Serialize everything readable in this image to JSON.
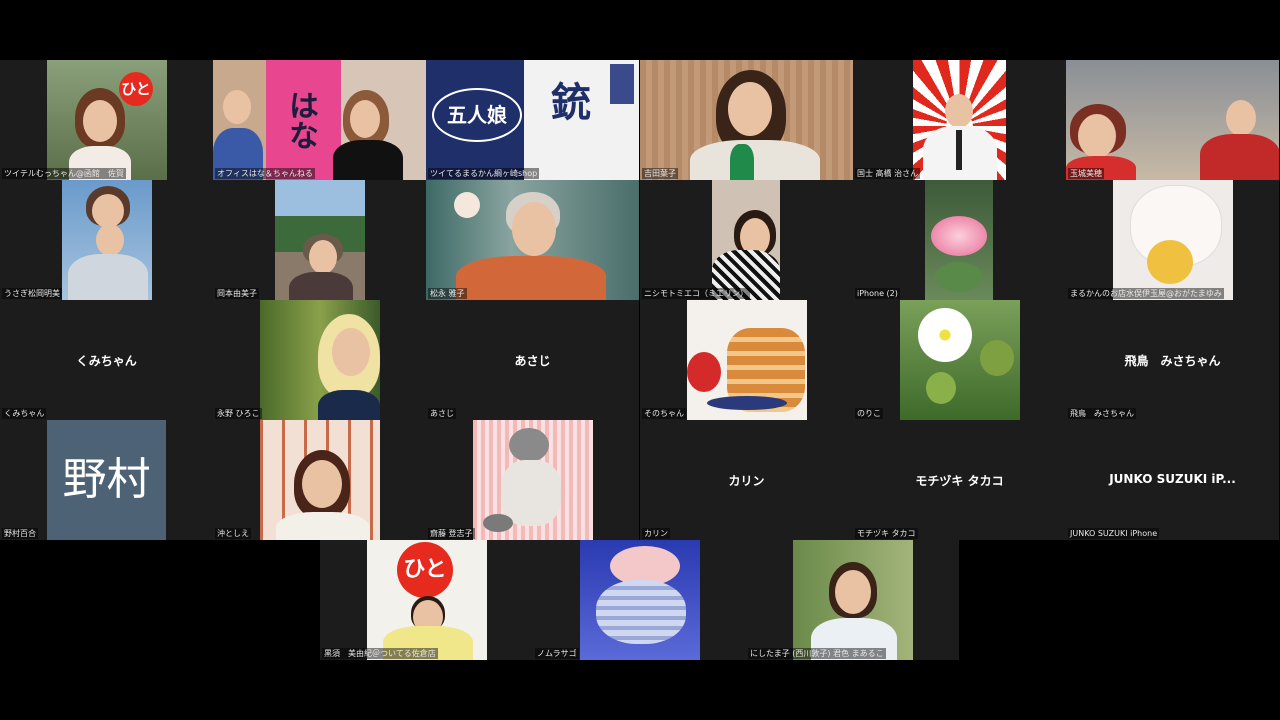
{
  "participants": [
    {
      "name": "ツイテルむっちゃん@函館　佐賀",
      "center": ""
    },
    {
      "name": "オフィスはな＆ちゃんねる",
      "center": ""
    },
    {
      "name": "ツイてるまるかん綱ヶ崎shop",
      "center": ""
    },
    {
      "name": "吉田葉子",
      "center": ""
    },
    {
      "name": "国士 髙橋 治さん",
      "center": ""
    },
    {
      "name": "玉城美穂",
      "center": ""
    },
    {
      "name": "うさぎ松岡明美",
      "center": ""
    },
    {
      "name": "岡本由美子",
      "center": ""
    },
    {
      "name": "松永 雅子",
      "center": ""
    },
    {
      "name": "ニシモトミエコ（ミエリン）",
      "center": ""
    },
    {
      "name": "iPhone (2)",
      "center": ""
    },
    {
      "name": "まるかんのお店水俣伊玉屋@おがたまゆみ",
      "center": ""
    },
    {
      "name": "くみちゃん",
      "center": "くみちゃん"
    },
    {
      "name": "永野 ひろこ",
      "center": ""
    },
    {
      "name": "あさじ",
      "center": "あさじ"
    },
    {
      "name": "そのちゃん",
      "center": ""
    },
    {
      "name": "のりこ",
      "center": ""
    },
    {
      "name": "飛鳥　みさちゃん",
      "center": "飛鳥　みさちゃん"
    },
    {
      "name": "野村百合",
      "center": "",
      "avatar": "野村"
    },
    {
      "name": "沖としえ",
      "center": ""
    },
    {
      "name": "齋藤 登志子",
      "center": ""
    },
    {
      "name": "カリン",
      "center": "カリン"
    },
    {
      "name": "モチヅキ タカコ",
      "center": "モチヅキ タカコ"
    },
    {
      "name": "JUNKO SUZUKI iPhone",
      "center": "JUNKO SUZUKI iP..."
    },
    {
      "name": "黒須　美由紀＠ついてる佐倉店",
      "center": ""
    },
    {
      "name": "ノムラサゴ",
      "center": ""
    },
    {
      "name": "にしたま子 (西川敦子) 君色 まあるこ",
      "center": ""
    }
  ],
  "logos": {
    "hitori": "ひと"
  },
  "banners": {
    "gomusume": "五人娘",
    "hana": "はな"
  },
  "colors": {
    "background": "#000000",
    "tile": "#1c1c1c",
    "avatar": "#4d6275"
  }
}
